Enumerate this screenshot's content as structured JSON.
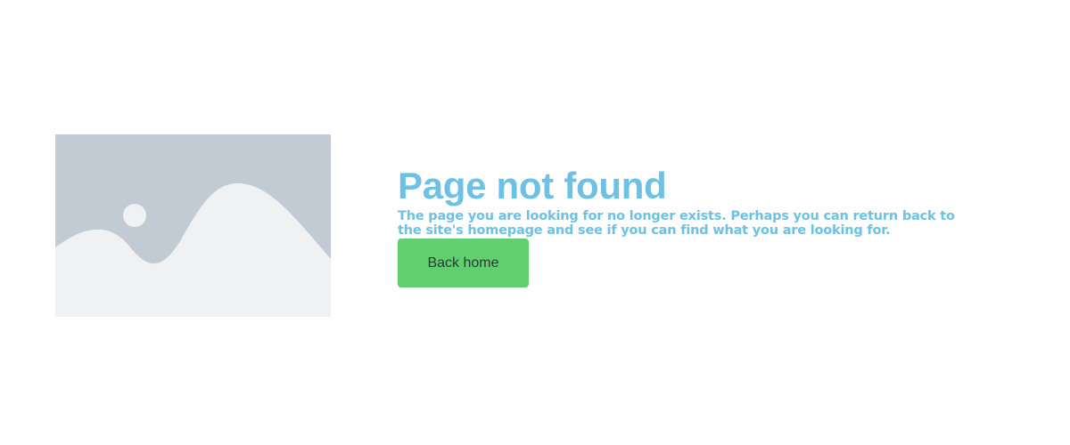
{
  "error": {
    "title": "Page not found",
    "message": "The page you are looking for no longer exists. Perhaps you can return back to the site's homepage and see if you can find what you are looking for.",
    "back_button_label": "Back home"
  },
  "illustration": {
    "icon": "image-placeholder-icon"
  },
  "colors": {
    "accent": "#6ec1e4",
    "button": "#61ce70",
    "button_text": "#2b3a36",
    "placeholder_bg": "#c2cbd3",
    "placeholder_fg": "#eff1f3"
  }
}
